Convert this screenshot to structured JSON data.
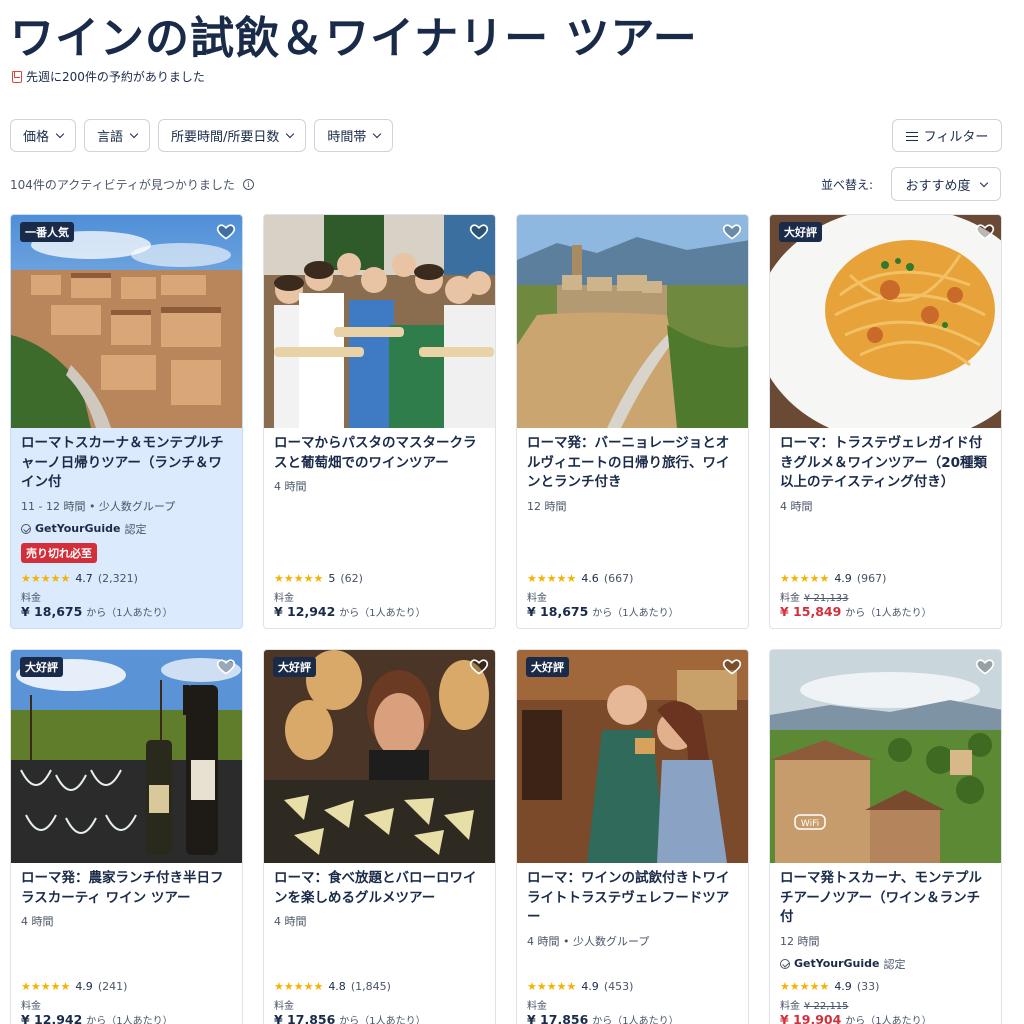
{
  "page": {
    "title": "ワインの試飲＆ワイナリー ツアー",
    "booked_text": "先週に200件の予約がありました"
  },
  "filters": [
    {
      "label": "価格"
    },
    {
      "label": "言語"
    },
    {
      "label": "所要時間/所要日数"
    },
    {
      "label": "時間帯"
    }
  ],
  "filter_button": {
    "label": "フィルター"
  },
  "results": {
    "count_text": "104件のアクティビティが見つかりました"
  },
  "sort": {
    "label": "並べ替え:",
    "value": "おすすめ度"
  },
  "cards": [
    {
      "badge": "一番人気",
      "title": "ローマトスカーナ＆モンテプルチャーノ日帰りツアー（ランチ＆ワイン付",
      "meta": "11 - 12 時間 • 少人数グループ",
      "certified": "認定",
      "certified_brand": "GetYourGuide",
      "soldout": "売り切れ必至",
      "stars": "★★★★★",
      "rating": "4.7",
      "reviews": "(2,321)",
      "price_label": "料金",
      "old_price": "",
      "price": "¥ 18,675",
      "from": "から（1人あたり）",
      "highlight": true
    },
    {
      "badge": "",
      "title": "ローマからパスタのマスタークラスと葡萄畑でのワインツアー",
      "meta": "4 時間",
      "stars": "★★★★★",
      "rating": "5",
      "reviews": "(62)",
      "price_label": "料金",
      "old_price": "",
      "price": "¥ 12,942",
      "from": "から（1人あたり）"
    },
    {
      "badge": "",
      "title": "ローマ発：バーニョレージョとオルヴィエートの日帰り旅行、ワインとランチ付き",
      "meta": "12 時間",
      "stars": "★★★★★",
      "rating": "4.6",
      "reviews": "(667)",
      "price_label": "料金",
      "old_price": "",
      "price": "¥ 18,675",
      "from": "から（1人あたり）"
    },
    {
      "badge": "大好評",
      "title": "ローマ：トラステヴェレガイド付きグルメ＆ワインツアー（20種類以上のテイスティング付き）",
      "meta": "4 時間",
      "stars": "★★★★★",
      "rating": "4.9",
      "reviews": "(967)",
      "price_label": "料金",
      "old_price": "¥ 21,133",
      "price": "¥ 15,849",
      "from": "から（1人あたり）",
      "sale": true
    },
    {
      "badge": "大好評",
      "title": "ローマ発：農家ランチ付き半日フラスカーティ ワイン ツアー",
      "meta": "4 時間",
      "stars": "★★★★★",
      "rating": "4.9",
      "reviews": "(241)",
      "price_label": "料金",
      "old_price": "",
      "price": "¥ 12,942",
      "from": "から（1人あたり）"
    },
    {
      "badge": "大好評",
      "title": "ローマ：食べ放題とバローロワインを楽しめるグルメツアー",
      "meta": "4 時間",
      "stars": "★★★★★",
      "rating": "4.8",
      "reviews": "(1,845)",
      "price_label": "料金",
      "old_price": "",
      "price": "¥ 17,856",
      "from": "から（1人あたり）"
    },
    {
      "badge": "大好評",
      "title": "ローマ：ワインの試飲付きトワイライトトラステヴェレフードツアー",
      "meta": "4 時間 • 少人数グループ",
      "stars": "★★★★★",
      "rating": "4.9",
      "reviews": "(453)",
      "price_label": "料金",
      "old_price": "",
      "price": "¥ 17,856",
      "from": "から（1人あたり）"
    },
    {
      "badge": "",
      "title": "ローマ発トスカーナ、モンテプルチアーノツアー（ワイン＆ランチ付",
      "meta": "12 時間",
      "certified": "認定",
      "certified_brand": "GetYourGuide",
      "stars": "★★★★★",
      "rating": "4.9",
      "reviews": "(33)",
      "price_label": "料金",
      "old_price": "¥ 22,115",
      "price": "¥ 19,904",
      "from": "から（1人あたり）",
      "sale": true
    }
  ],
  "colors": {
    "navy": "#1a2b49",
    "accent_red": "#d32f3a",
    "star": "#f5b301",
    "highlight_bg": "#dbeafc"
  },
  "icons": [
    "bookmark-icon",
    "chevron-down-icon",
    "sliders-icon",
    "info-icon",
    "heart-icon",
    "check-circle-icon",
    "star-icon"
  ]
}
